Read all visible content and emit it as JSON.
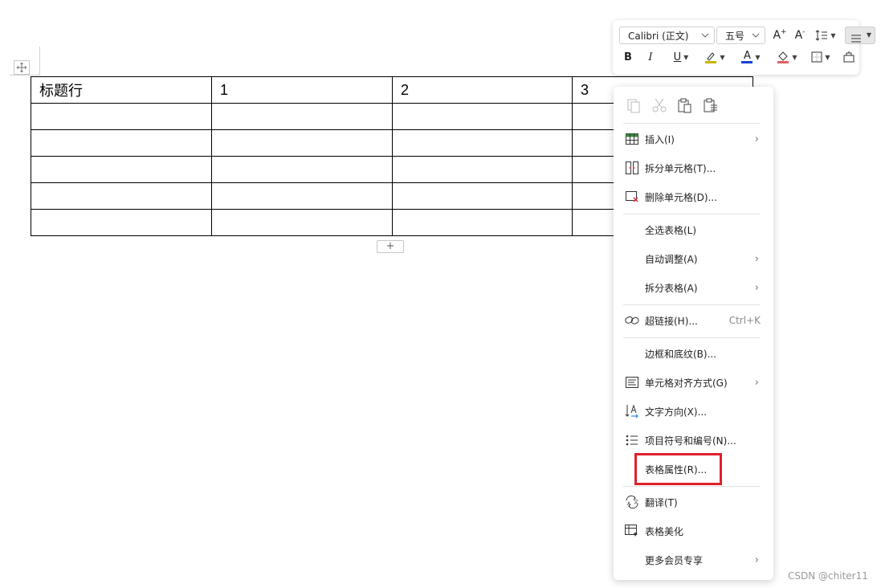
{
  "table": {
    "rows": [
      [
        "标题行",
        "1",
        "2",
        "3"
      ],
      [
        "",
        "",
        "",
        ""
      ],
      [
        "",
        "",
        "",
        ""
      ],
      [
        "",
        "",
        "",
        ""
      ],
      [
        "",
        "",
        "",
        ""
      ],
      [
        "",
        "",
        "",
        ""
      ]
    ],
    "add_row_label": "+"
  },
  "toolbar": {
    "font_name": "Calibri (正文)",
    "font_size": "五号",
    "bold": "B",
    "italic": "I",
    "underline": "U",
    "font_color_letter": "A",
    "grow_font": "A",
    "shrink_font": "A",
    "highlight_color": "#c8b400",
    "font_color": "#1a3fd6"
  },
  "context_menu": {
    "items": [
      {
        "label": "插入(I)",
        "icon": "insert-table-icon",
        "submenu": true
      },
      {
        "label": "拆分单元格(T)...",
        "icon": "split-cells-icon"
      },
      {
        "label": "删除单元格(D)...",
        "icon": "delete-cells-icon"
      },
      {
        "label": "全选表格(L)"
      },
      {
        "label": "自动调整(A)",
        "submenu": true
      },
      {
        "label": "拆分表格(A)",
        "submenu": true
      },
      {
        "label": "超链接(H)...",
        "icon": "hyperlink-icon",
        "shortcut": "Ctrl+K"
      },
      {
        "label": "边框和底纹(B)..."
      },
      {
        "label": "单元格对齐方式(G)",
        "icon": "cell-align-icon",
        "submenu": true
      },
      {
        "label": "文字方向(X)...",
        "icon": "text-direction-icon"
      },
      {
        "label": "项目符号和编号(N)...",
        "icon": "bullet-list-icon"
      },
      {
        "label": "表格属性(R)..."
      },
      {
        "label": "翻译(T)",
        "icon": "translate-icon"
      },
      {
        "label": "表格美化",
        "icon": "table-beautify-icon"
      },
      {
        "label": "更多会员专享",
        "submenu": true
      }
    ],
    "highlight_color": "#e0202b"
  },
  "watermark": "CSDN @chiter11"
}
